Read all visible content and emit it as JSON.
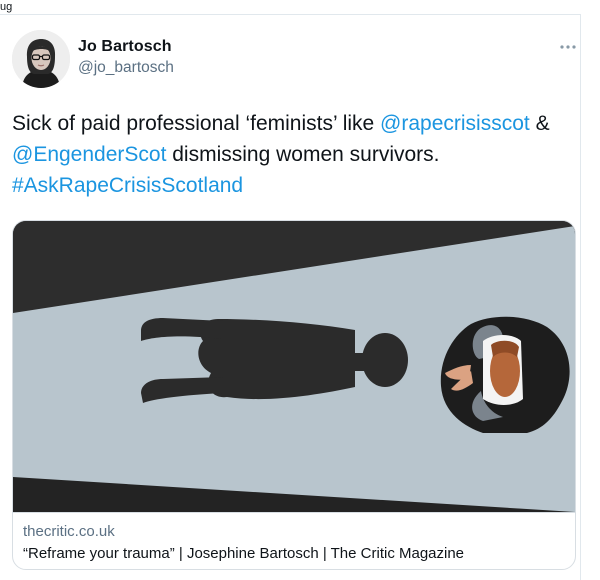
{
  "page": {
    "top_fragment": "ug"
  },
  "tweet": {
    "author": {
      "name": "Jo Bartosch",
      "handle": "@jo_bartosch",
      "avatar_icon": "profile-photo"
    },
    "more_icon": "more-horizontal-icon",
    "text": {
      "part1": "Sick of paid professional ‘feminists’ like ",
      "mention1": "@rapecrisisscot",
      "part2": " & ",
      "mention2": "@EngenderScot",
      "part3": " dismissing women survivors. ",
      "hashtag": "#AskRapeCrisisScotland"
    },
    "link_color": "#1b95e0",
    "card": {
      "domain": "thecritic.co.uk",
      "title": "“Reframe your trauma” | Josephine Bartosch | The Critic Magazine"
    }
  }
}
